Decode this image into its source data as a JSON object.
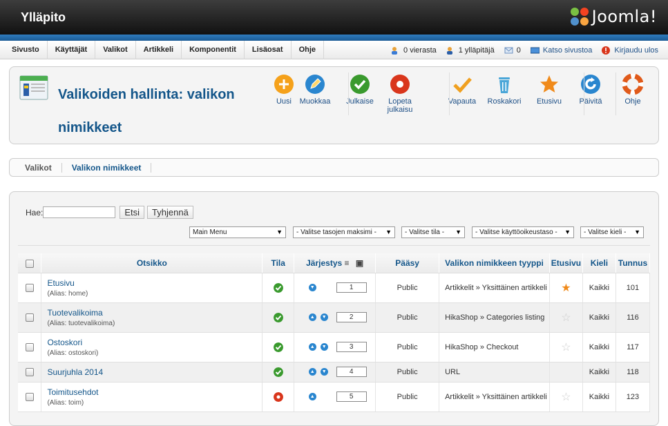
{
  "header": {
    "title": "Ylläpito",
    "logo_text": "Joomla!"
  },
  "menu": [
    "Sivusto",
    "Käyttäjät",
    "Valikot",
    "Artikkeli",
    "Komponentit",
    "Lisäosat",
    "Ohje"
  ],
  "status": {
    "visitors": "0 vierasta",
    "admins": "1 ylläpitäjä",
    "messages": "0",
    "view_site": "Katso sivustoa",
    "logout": "Kirjaudu ulos"
  },
  "page_title": "Valikoiden hallinta: valikon nimikkeet",
  "toolbar": [
    {
      "label": "Uusi",
      "icon": "plus-icon",
      "color": "#f5a11a"
    },
    {
      "label": "Muokkaa",
      "icon": "pencil-icon",
      "color": "#2a86cf"
    },
    {
      "label": "Julkaise",
      "icon": "check-icon",
      "color": "#3a9a2e"
    },
    {
      "label": "Lopeta julkaisu",
      "icon": "unpublish-icon",
      "color": "#d9361c"
    },
    {
      "label": "Vapauta",
      "icon": "checkin-icon",
      "color": "#f0a020"
    },
    {
      "label": "Roskakori",
      "icon": "trash-icon",
      "color": "#4aa6d8"
    },
    {
      "label": "Etusivu",
      "icon": "star-icon",
      "color": "#f08a1a"
    },
    {
      "label": "Päivitä",
      "icon": "refresh-icon",
      "color": "#2a86cf"
    },
    {
      "label": "Ohje",
      "icon": "lifebuoy-icon",
      "color": "#e05a1a"
    }
  ],
  "submenu": [
    "Valikot",
    "Valikon nimikkeet"
  ],
  "filter": {
    "search_label": "Hae:",
    "search_value": "",
    "search_button": "Etsi",
    "clear_button": "Tyhjennä",
    "selects": [
      "Main Menu",
      "- Valitse tasojen maksimi -",
      "- Valitse tila -",
      "- Valitse käyttöoikeustaso -",
      "- Valitse kieli -"
    ]
  },
  "table": {
    "headers": [
      "Otsikko",
      "Tila",
      "Järjestys",
      "Pääsy",
      "Valikon nimikkeen tyyppi",
      "Etusivu",
      "Kieli",
      "Tunnus"
    ],
    "rows": [
      {
        "title": "Etusivu",
        "alias": "(Alias: home)",
        "state": "published",
        "up": false,
        "down": true,
        "order": "1",
        "access": "Public",
        "type": "Artikkelit » Yksittäinen artikkeli",
        "home": true,
        "lang": "Kaikki",
        "id": "101"
      },
      {
        "title": "Tuotevalikoima",
        "alias": "(Alias: tuotevalikoima)",
        "state": "published",
        "up": true,
        "down": true,
        "order": "2",
        "access": "Public",
        "type": "HikaShop » Categories listing",
        "home": false,
        "lang": "Kaikki",
        "id": "116"
      },
      {
        "title": "Ostoskori",
        "alias": "(Alias: ostoskori)",
        "state": "published",
        "up": true,
        "down": true,
        "order": "3",
        "access": "Public",
        "type": "HikaShop » Checkout",
        "home": false,
        "lang": "Kaikki",
        "id": "117"
      },
      {
        "title": "Suurjuhla 2014",
        "alias": "",
        "state": "published",
        "up": true,
        "down": true,
        "order": "4",
        "access": "Public",
        "type": "URL",
        "home": null,
        "lang": "Kaikki",
        "id": "118"
      },
      {
        "title": "Toimitusehdot",
        "alias": "(Alias: toim)",
        "state": "unpublished",
        "up": true,
        "down": false,
        "order": "5",
        "access": "Public",
        "type": "Artikkelit » Yksittäinen artikkeli",
        "home": false,
        "lang": "Kaikki",
        "id": "123"
      }
    ]
  }
}
